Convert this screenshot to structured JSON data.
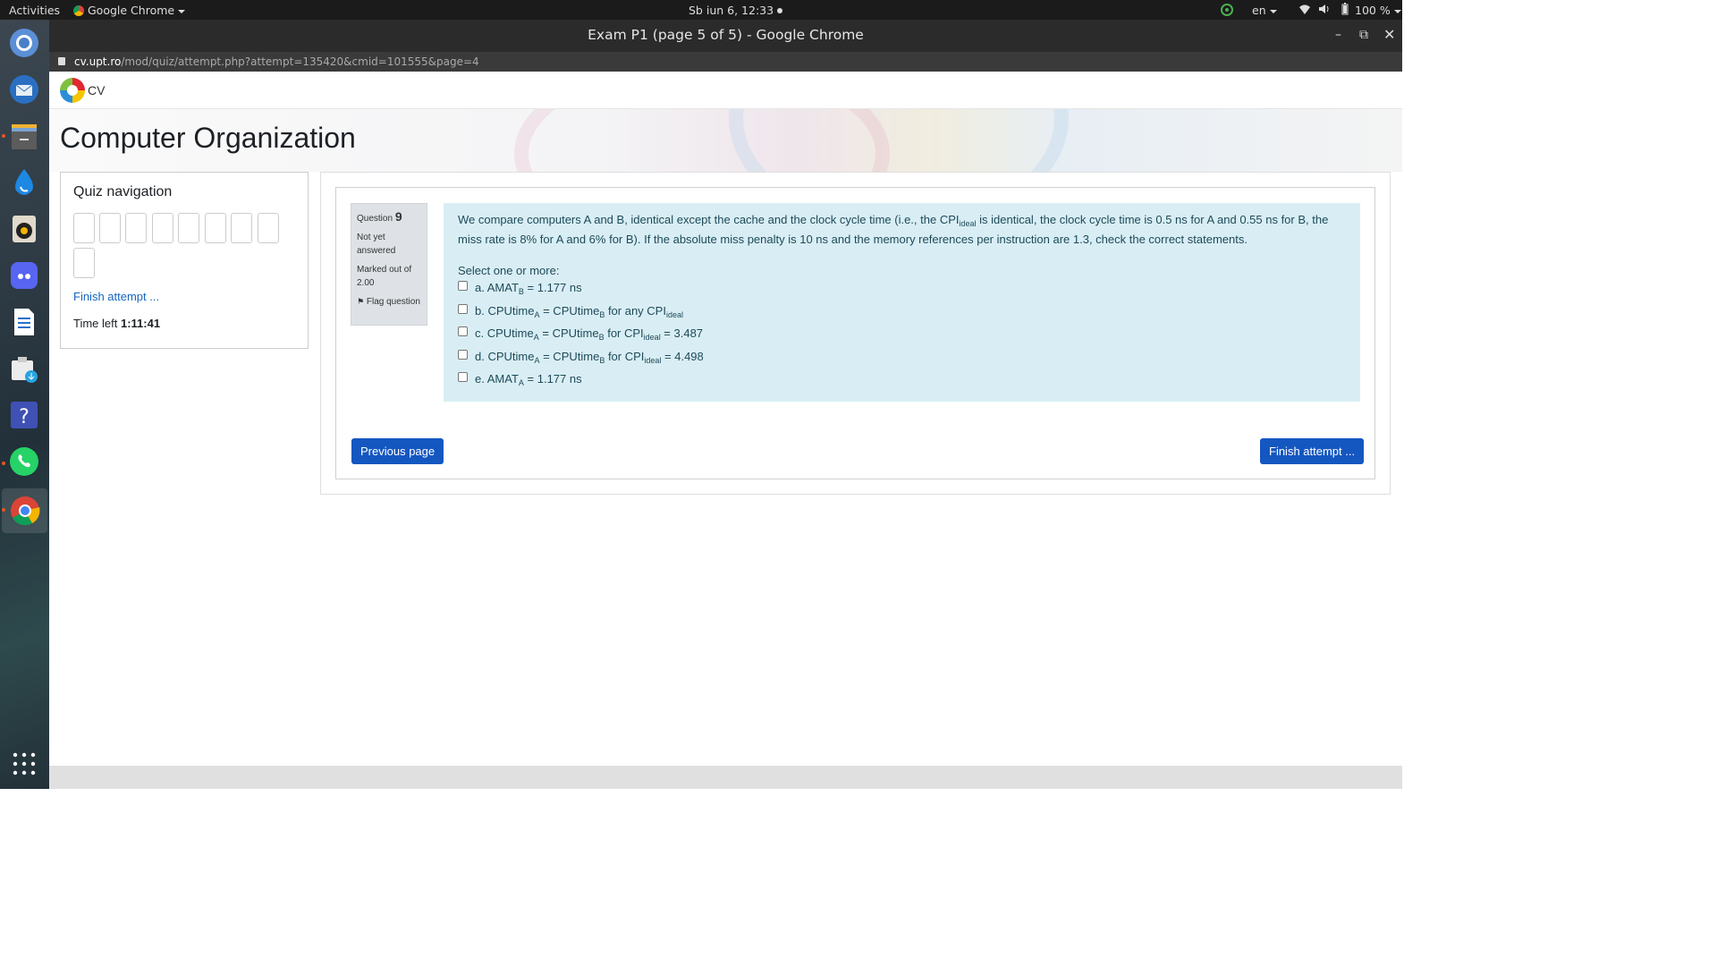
{
  "system": {
    "activities": "Activities",
    "app_menu": "Google Chrome",
    "clock": "Sb iun  6, 12:33",
    "lang": "en",
    "battery": "100 %"
  },
  "window": {
    "title": "Exam P1 (page 5 of 5) - Google Chrome"
  },
  "url": {
    "host": "cv.upt.ro",
    "path": "/mod/quiz/attempt.php?attempt=135420&cmid=101555&page=4"
  },
  "site": {
    "name": "CV",
    "course_title": "Computer Organization"
  },
  "quiz_nav": {
    "heading": "Quiz navigation",
    "finish_link": "Finish attempt ...",
    "time_label": "Time left",
    "time_value": "1:11:41",
    "question_count": 9
  },
  "question": {
    "label": "Question",
    "number": "9",
    "status": "Not yet answered",
    "marked": "Marked out of 2.00",
    "flag": "Flag question",
    "stem_part1": "We compare computers A and B, identical except the cache and the clock cycle time (i.e., the CPI",
    "stem_sub": "ideal",
    "stem_part2": " is identical, the clock cycle time is 0.5 ns for A and 0.55 ns for B, the miss rate is 8% for A and 6% for B). If the absolute miss penalty is 10 ns and the memory references per instruction are 1.3, check the correct statements.",
    "prompt": "Select one or more:",
    "options": [
      {
        "a": "a. AMAT",
        "as": "B",
        "b": " = 1.177 ns",
        "bs": "",
        "c": ""
      },
      {
        "a": "b. CPUtime",
        "as": "A",
        "b": " = CPUtime",
        "bs": "B",
        "c": " for any CPI",
        "cs": "ideal",
        "d": ""
      },
      {
        "a": "c. CPUtime",
        "as": "A",
        "b": " = CPUtime",
        "bs": "B",
        "c": " for CPI",
        "cs": "ideal",
        "d": " = 3.487"
      },
      {
        "a": "d. CPUtime",
        "as": "A",
        "b": " = CPUtime",
        "bs": "B",
        "c": " for CPI",
        "cs": "ideal",
        "d": " = 4.498"
      },
      {
        "a": "e. AMAT",
        "as": "A",
        "b": " = 1.177 ns",
        "bs": "",
        "c": ""
      }
    ]
  },
  "buttons": {
    "previous": "Previous page",
    "finish": "Finish attempt ..."
  }
}
